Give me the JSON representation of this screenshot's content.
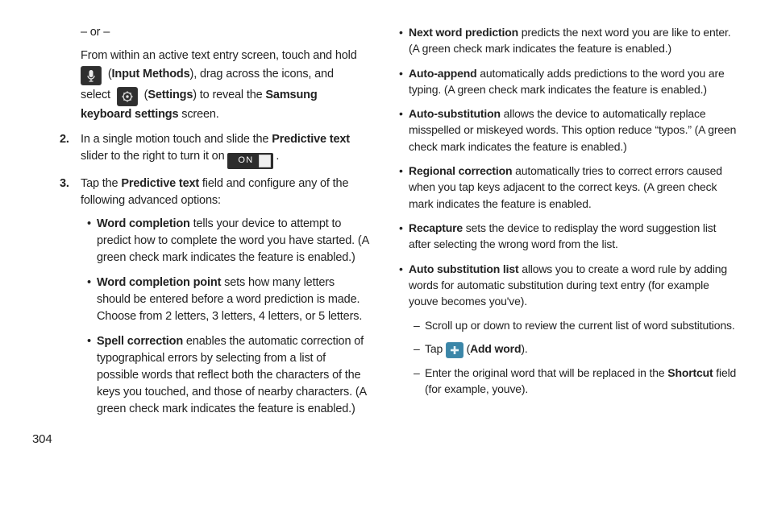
{
  "page_number": "304",
  "left": {
    "or": "– or –",
    "intro1": "From within an active text entry screen, touch and hold",
    "input_methods": "Input Methods",
    "intro2_tail": ", drag across the icons, and",
    "select": "select",
    "settings": "Settings",
    "reveal": " to reveal the ",
    "samsung_kb": "Samsung keyboard settings",
    "screen": " screen.",
    "step2_num": "2.",
    "step2_a": "In a single motion touch and slide the ",
    "predictive_text": "Predictive text",
    "step2_b": " slider to the right to turn it on ",
    "on_label": "ON",
    "step3_num": "3.",
    "step3_a": "Tap the ",
    "step3_b": " field and configure any of the following advanced options:",
    "b1_title": "Word completion",
    "b1_body": " tells your device to attempt to predict how to complete the word you have started. (A green check mark indicates the feature is enabled.)",
    "b2_title": "Word completion point",
    "b2_body": " sets how many letters should be entered before a word prediction is made. Choose from 2 letters, 3 letters, 4 letters, or 5 letters.",
    "b3_title": "Spell correction",
    "b3_body": " enables the automatic correction of typographical errors by selecting from a list of possible words that reflect both the characters of the keys you touched, and those of nearby characters. (A green check mark indicates the feature is enabled.)"
  },
  "right": {
    "r1_title": "Next word prediction",
    "r1_body": " predicts the next word you are like to enter. (A green check mark indicates the feature is enabled.)",
    "r2_title": "Auto-append",
    "r2_body": " automatically adds predictions to the word you are typing. (A green check mark indicates the feature is enabled.)",
    "r3_title": "Auto-substitution",
    "r3_body": " allows the device to automatically replace misspelled or miskeyed words. This option reduce “typos.” (A green check mark indicates the feature is enabled.)",
    "r4_title": "Regional correction",
    "r4_body": " automatically tries to correct errors caused when you tap keys adjacent to the correct keys. (A green check mark indicates the feature is enabled.",
    "r5_title": "Recapture",
    "r5_body": " sets the device to redisplay the word suggestion list after selecting the wrong word from the list.",
    "r6_title": "Auto substitution list",
    "r6_body": " allows you to create a word rule by adding words for automatic substitution during text entry (for example youve becomes you've).",
    "d1": "Scroll up or down to review the current list of word substitutions.",
    "d2_tap": "Tap ",
    "d2_addword": "Add word",
    "d2_tail": ".",
    "d3_a": "Enter the original word that will be replaced in the ",
    "d3_shortcut": "Shortcut",
    "d3_b": " field (for example, youve)."
  }
}
